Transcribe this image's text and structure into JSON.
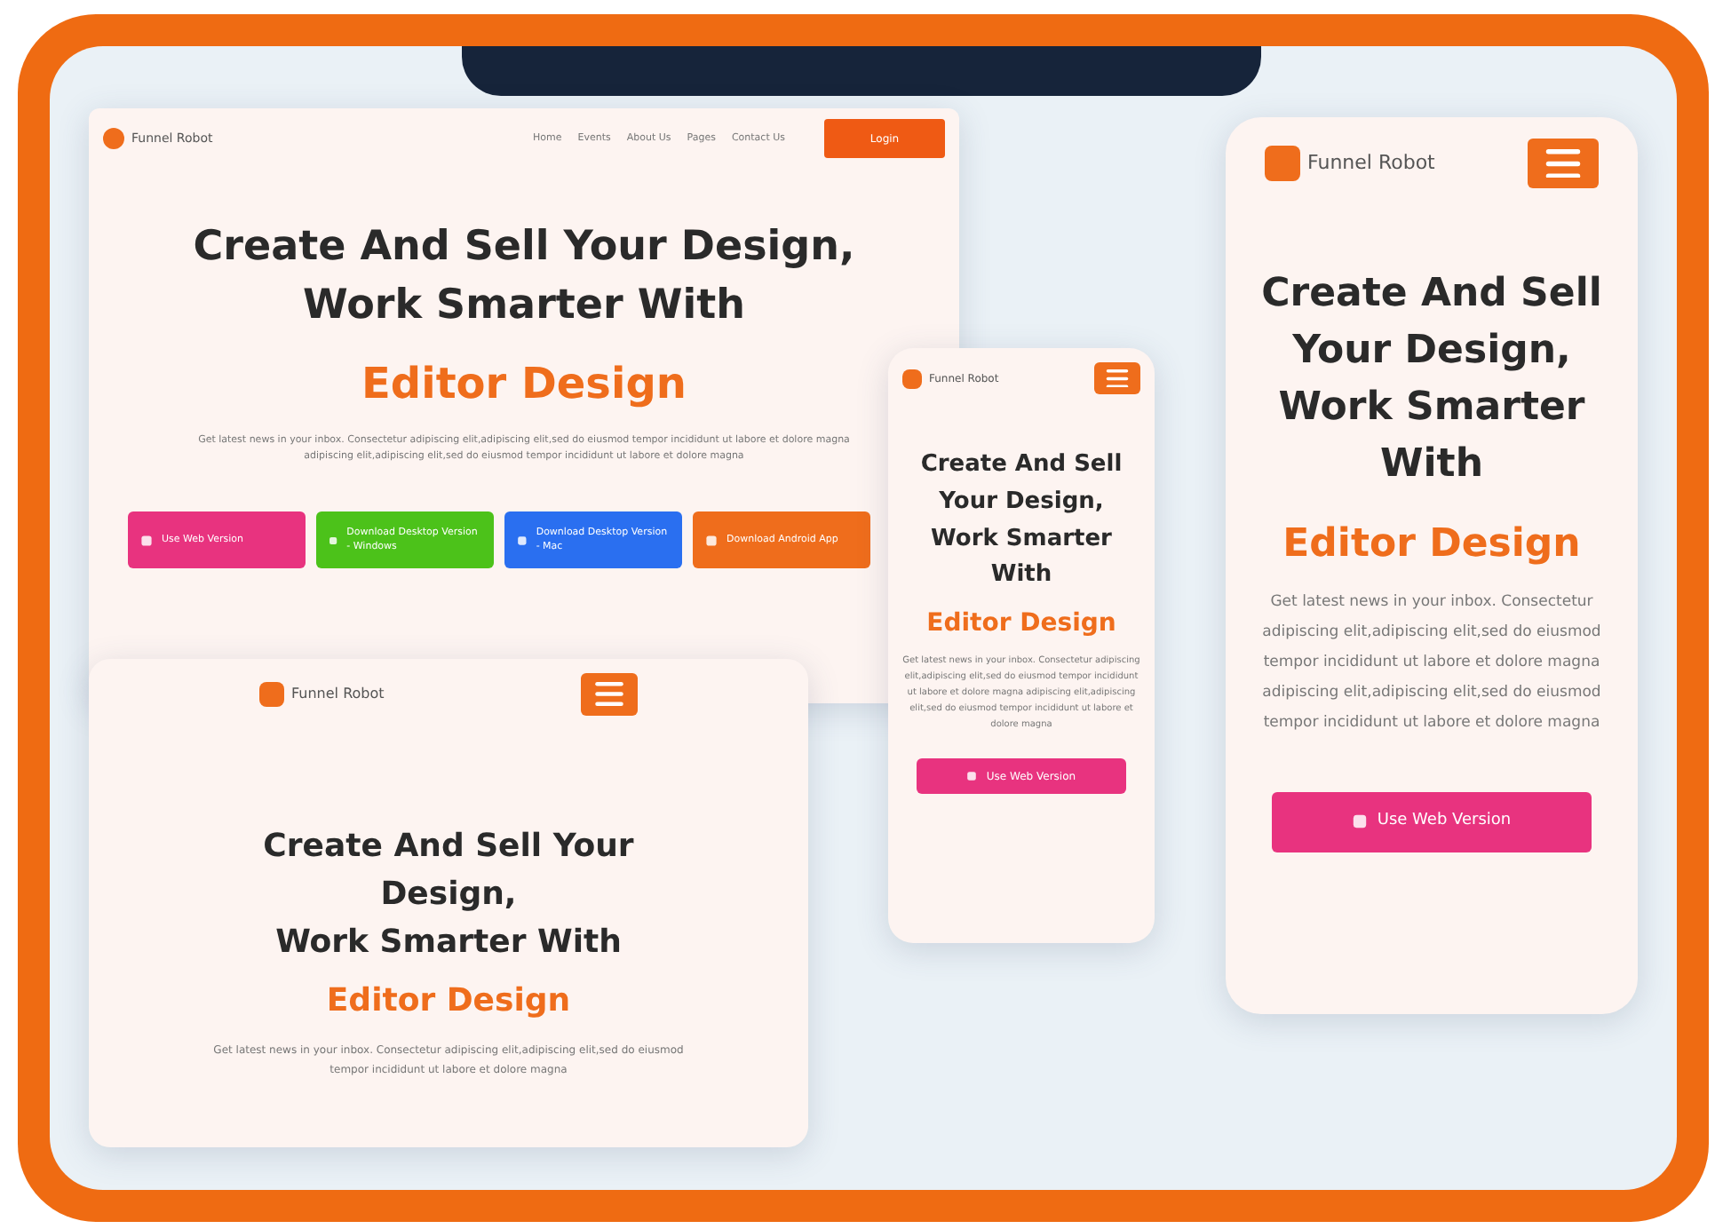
{
  "mockups": [
    {
      "kind": "desktop",
      "logo": "Funnel Robot",
      "nav": [
        "Home",
        "Events",
        "About Us",
        "Pages",
        "Contact Us"
      ],
      "login": "Login",
      "heading": [
        "Create And Sell Your Design,",
        "Work Smarter With"
      ],
      "accent": "Editor Design",
      "paragraph": "Get latest news in your inbox. Consectetur adipiscing elit,adipiscing elit,sed do eiusmod tempor incididunt ut labore et dolore magna adipiscing elit,adipiscing elit,sed do eiusmod tempor incididunt ut labore et dolore magna",
      "buttons": [
        {
          "label": "Use Web Version",
          "color": "#e8337f"
        },
        {
          "label": "Download Desktop Version - Windows",
          "color": "#4cc21a"
        },
        {
          "label": "Download Desktop Version - Mac",
          "color": "#2a6ff0"
        },
        {
          "label": "Download Android App",
          "color": "#ef6d1c"
        }
      ]
    },
    {
      "kind": "tablet",
      "logo": "Funnel Robot",
      "heading": [
        "Create And Sell Your Design,",
        "Work Smarter With"
      ],
      "accent": "Editor Design",
      "paragraph": "Get latest news in your inbox. Consectetur adipiscing elit,adipiscing elit,sed do eiusmod tempor incididunt ut labore et dolore magna"
    },
    {
      "kind": "phone-small",
      "logo": "Funnel Robot",
      "heading": [
        "Create And Sell Your Design, Work Smarter With"
      ],
      "accent": "Editor Design",
      "paragraph": "Get latest news in your inbox. Consectetur adipiscing elit,adipiscing elit,sed do eiusmod tempor incididunt ut labore et dolore magna adipiscing elit,adipiscing elit,sed do eiusmod tempor incididunt ut labore et dolore magna",
      "buttons": [
        {
          "label": "Use Web Version",
          "color": "#e8337f"
        }
      ]
    },
    {
      "kind": "phone-large",
      "logo": "Funnel Robot",
      "heading": [
        "Create And Sell Your Design, Work Smarter With"
      ],
      "accent": "Editor Design",
      "paragraph": "Get latest news in your inbox. Consectetur adipiscing elit,adipiscing elit,sed do eiusmod tempor incididunt ut labore et dolore magna adipiscing elit,adipiscing elit,sed do eiusmod tempor incididunt ut labore et dolore magna",
      "buttons": [
        {
          "label": "Use Web Version",
          "color": "#e8337f"
        }
      ]
    }
  ]
}
